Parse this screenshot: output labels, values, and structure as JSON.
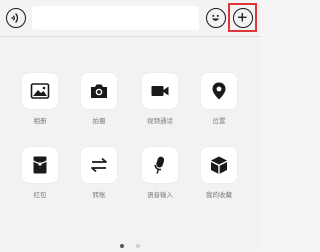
{
  "input_bar": {
    "placeholder": "",
    "voice_icon": "voice-icon",
    "emoji_icon": "emoji-icon",
    "plus_icon": "plus-icon"
  },
  "annotation": {
    "highlight_color": "#e0353a",
    "arrow_color": "#e0353a"
  },
  "panel": {
    "items": [
      {
        "label": "相册",
        "icon": "image-icon"
      },
      {
        "label": "拍摄",
        "icon": "camera-icon"
      },
      {
        "label": "视频通话",
        "icon": "video-call-icon"
      },
      {
        "label": "位置",
        "icon": "location-icon"
      },
      {
        "label": "红包",
        "icon": "red-envelope-icon"
      },
      {
        "label": "转账",
        "icon": "transfer-icon"
      },
      {
        "label": "语音输入",
        "icon": "microphone-icon"
      },
      {
        "label": "我的收藏",
        "icon": "favorites-cube-icon"
      }
    ],
    "page_indicator": {
      "pages": 2,
      "current": 1
    }
  }
}
